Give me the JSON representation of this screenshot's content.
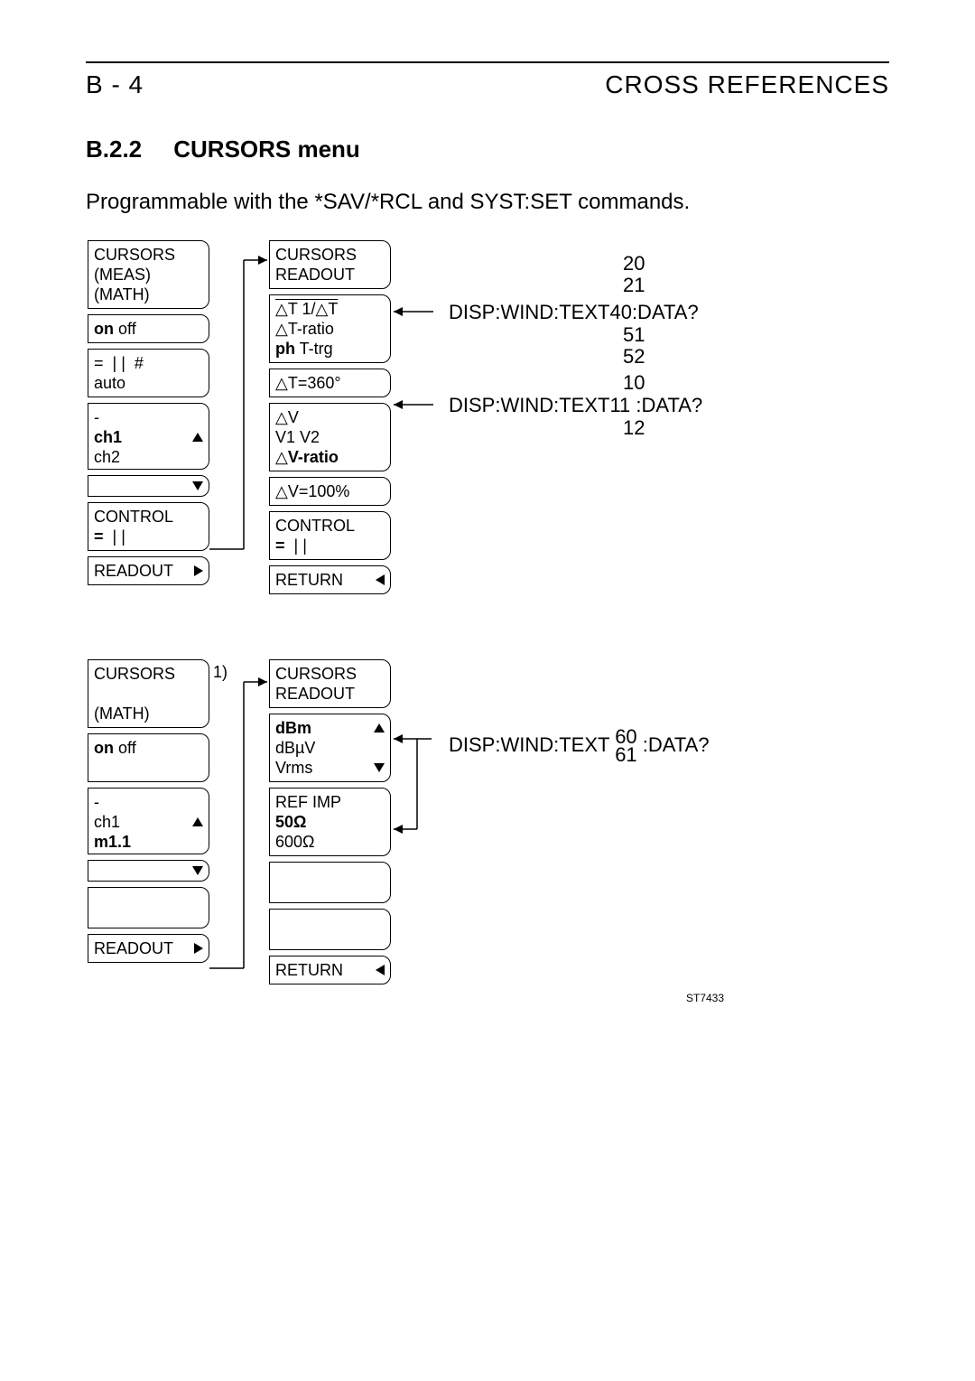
{
  "header": {
    "left": "B - 4",
    "right": "CROSS REFERENCES"
  },
  "section": {
    "number": "B.2.2",
    "title": "CURSORS menu"
  },
  "intro": "Programmable with the *SAV/*RCL and SYST:SET commands.",
  "panel_A": {
    "title_l1": "CURSORS",
    "title_l2": "(MEAS)",
    "title_l3": "(MATH)",
    "onoff_on": "on",
    "onoff_off": " off",
    "mode_eq": "=",
    "mode_bars": "| |",
    "mode_hash": "#",
    "mode_auto": "auto",
    "dash": "-",
    "ch1": "ch1",
    "ch2": "ch2",
    "control_label": "CONTROL",
    "control_eq": "=",
    "control_bars": "| |",
    "readout": "READOUT"
  },
  "panel_B": {
    "title_l1": "CURSORS",
    "title_l2": "READOUT",
    "l_dt": "△T  1/△T",
    "l_dtratio": "△T-ratio",
    "l_ph": "ph",
    "l_ttrg": " T-trg",
    "l_dt360": "△T=360°",
    "l_dv": "△V",
    "l_v1v2": "V1 V2",
    "l_dvratio_sym": "△",
    "l_dvratio_txt": "V-ratio",
    "l_dv100": "△V=100%",
    "control_label": "CONTROL",
    "control_eq": "=",
    "control_bars": "| |",
    "return": "RETURN"
  },
  "panel_C": {
    "title_l1": "CURSORS",
    "note1": "1)",
    "title_l3": "(MATH)",
    "onoff_on": "on",
    "onoff_off": " off",
    "dash": "-",
    "ch1": "ch1",
    "m11": "m1.1",
    "readout": "READOUT"
  },
  "panel_D": {
    "title_l1": "CURSORS",
    "title_l2": "READOUT",
    "dBm": "dBm",
    "dBuV": "dBµV",
    "Vrms": "Vrms",
    "refimp": "REF IMP",
    "r50": "50Ω",
    "r600": "600Ω",
    "return": "RETURN"
  },
  "annot": {
    "q1_base": "DISP:WIND:TEXT",
    "q1_tail": ":DATA?",
    "q1_nums": [
      "20",
      "21",
      "40",
      "51",
      "52"
    ],
    "q2_base": "DISP:WIND:TEXT",
    "q2_tail": ":DATA?",
    "q2_nums": [
      "10",
      "11",
      "12"
    ],
    "q3_base": "DISP:WIND:TEXT",
    "q3_tail": ":DATA?",
    "q3_nums": [
      "60",
      "61"
    ]
  },
  "figure_id": "ST7433"
}
